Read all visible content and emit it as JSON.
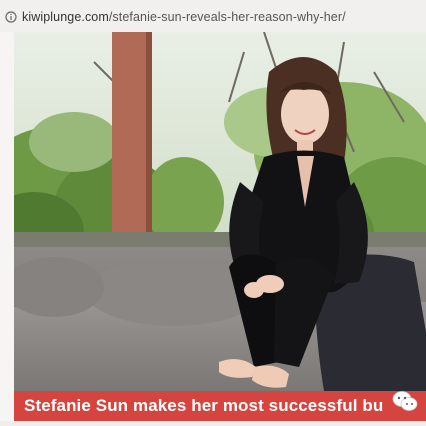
{
  "browser": {
    "url_domain": "kiwiplunge.com",
    "url_path": "/stefanie-sun-reveals-her-reason-why-her/",
    "url_icon": "info-circle-icon"
  },
  "article": {
    "headline": "Stefanie Sun makes her most successful bu",
    "photo_subject": "photo-of-woman-seated-on-couch"
  },
  "watermark": {
    "icon": "wechat-logo-icon"
  },
  "colors": {
    "headline_bg": "#d5443e",
    "headline_text": "#ffffff"
  }
}
